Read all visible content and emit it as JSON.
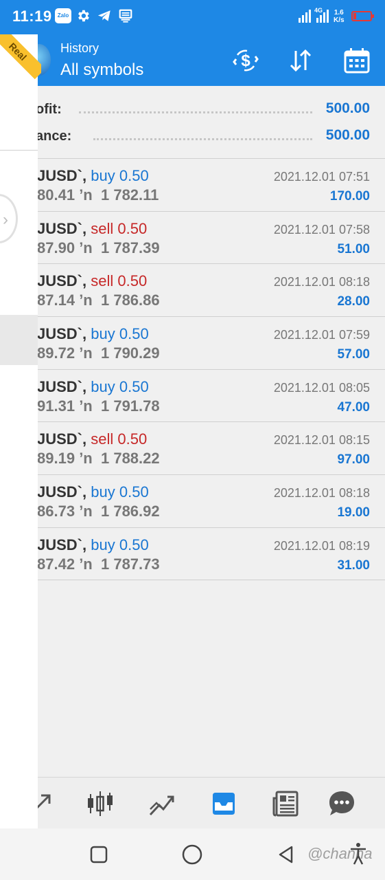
{
  "status_bar": {
    "time": "11:19",
    "zalo_label": "Zalo",
    "network_speed": "1.6",
    "network_unit": "K/s",
    "network_type": "4G",
    "battery_level": 0.15,
    "icons": [
      "zalo-icon",
      "settings-icon",
      "telegram-icon",
      "message-icon",
      "signal-icon",
      "battery-icon"
    ]
  },
  "app_bar": {
    "subtitle": "History",
    "title": "All symbols",
    "account_badge": "Real",
    "icons": [
      "currency-exchange-icon",
      "sort-icon",
      "calendar-icon"
    ]
  },
  "summary": {
    "profit_label": "ofit:",
    "profit_value": "500.00",
    "balance_label": "ance:",
    "balance_value": "500.00"
  },
  "deals": [
    {
      "symbol": "JUSD`,",
      "side": "buy",
      "volume": "0.50",
      "open": "80.41",
      "arrow": "’n",
      "close": "1 782.11",
      "datetime": "2021.12.01 07:51",
      "profit": "170.00"
    },
    {
      "symbol": "JUSD`,",
      "side": "sell",
      "volume": "0.50",
      "open": "87.90",
      "arrow": "’n",
      "close": "1 787.39",
      "datetime": "2021.12.01 07:58",
      "profit": "51.00"
    },
    {
      "symbol": "JUSD`,",
      "side": "sell",
      "volume": "0.50",
      "open": "87.14",
      "arrow": "’n",
      "close": "1 786.86",
      "datetime": "2021.12.01 08:18",
      "profit": "28.00"
    },
    {
      "symbol": "JUSD`,",
      "side": "buy",
      "volume": "0.50",
      "open": "89.72",
      "arrow": "’n",
      "close": "1 790.29",
      "datetime": "2021.12.01 07:59",
      "profit": "57.00"
    },
    {
      "symbol": "JUSD`,",
      "side": "buy",
      "volume": "0.50",
      "open": "91.31",
      "arrow": "’n",
      "close": "1 791.78",
      "datetime": "2021.12.01 08:05",
      "profit": "47.00"
    },
    {
      "symbol": "JUSD`,",
      "side": "sell",
      "volume": "0.50",
      "open": "89.19",
      "arrow": "’n",
      "close": "1 788.22",
      "datetime": "2021.12.01 08:15",
      "profit": "97.00"
    },
    {
      "symbol": "JUSD`,",
      "side": "buy",
      "volume": "0.50",
      "open": "86.73",
      "arrow": "’n",
      "close": "1 786.92",
      "datetime": "2021.12.01 08:18",
      "profit": "19.00"
    },
    {
      "symbol": "JUSD`,",
      "side": "buy",
      "volume": "0.50",
      "open": "87.42",
      "arrow": "’n",
      "close": "1 787.73",
      "datetime": "2021.12.01 08:19",
      "profit": "31.00"
    }
  ],
  "bottom_nav": {
    "items": [
      "quotes-icon",
      "chart-candles-icon",
      "trade-icon",
      "history-icon",
      "news-icon",
      "chat-icon"
    ],
    "active": "history-icon"
  },
  "system_nav": {
    "items": [
      "recents-icon",
      "home-icon",
      "back-icon",
      "accessibility-icon"
    ],
    "watermark": "@channa"
  },
  "colors": {
    "primary": "#1e88e5",
    "buy": "#1976d2",
    "sell": "#c62828",
    "badge": "#f9c02d"
  }
}
